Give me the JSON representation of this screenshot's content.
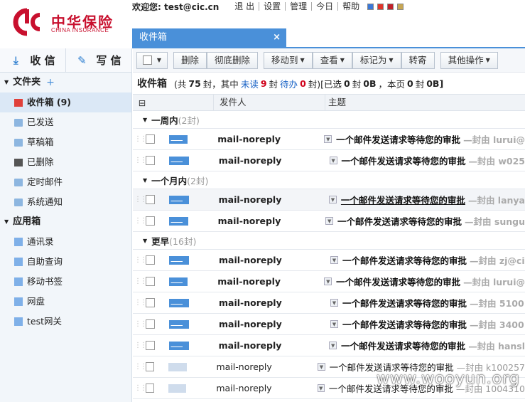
{
  "header": {
    "logo_cn": "中华保险",
    "logo_en": "CHINA INSURANCE",
    "welcome": "欢迎您: test@cic.cn",
    "links": [
      "退 出",
      "设置",
      "管理",
      "今日",
      "帮助"
    ],
    "skins": [
      "#3b78d8",
      "#e0352b",
      "#c0202a",
      "#c7a653"
    ]
  },
  "tab": {
    "label": "收件箱",
    "close": "×"
  },
  "sidebar": {
    "receive": "收 信",
    "compose": "写 信",
    "folders_title": "文件夹",
    "plus": "+",
    "folders": [
      {
        "label": "收件箱 (9)"
      },
      {
        "label": "已发送"
      },
      {
        "label": "草稿箱"
      },
      {
        "label": "已删除"
      },
      {
        "label": "定时邮件"
      },
      {
        "label": "系统通知"
      }
    ],
    "apps_title": "应用箱",
    "apps": [
      {
        "label": "通讯录"
      },
      {
        "label": "自助查询"
      },
      {
        "label": "移动书签"
      },
      {
        "label": "网盘"
      },
      {
        "label": "test网关"
      }
    ]
  },
  "toolbar": {
    "delete": "删除",
    "perm_delete": "彻底删除",
    "move": "移动到",
    "view": "查看",
    "mark": "标记为",
    "forward": "转寄",
    "more": "其他操作"
  },
  "summary": {
    "title": "收件箱",
    "t1": "(共",
    "total": "75",
    "t2": "封，其中",
    "unread_label": "未读",
    "unread": "9",
    "t3": "封",
    "todo_label": "待办",
    "todo": "0",
    "t4": "封)",
    "sel_pre": "[已选",
    "sel_count": "0",
    "sel_mid": "封",
    "sel_size": "0B",
    "sel_sep": "，本页",
    "page_count": "0",
    "page_mid": "封",
    "page_size": "0B]"
  },
  "columns": {
    "sender": "发件人",
    "subject": "主题"
  },
  "groups": [
    {
      "label": "一周内",
      "count": "(2封)",
      "rows": [
        {
          "sender": "mail-noreply",
          "subject": "一个邮件发送请求等待您的审批",
          "from": "—封由 lurui@",
          "unread": true
        },
        {
          "sender": "mail-noreply",
          "subject": "一个邮件发送请求等待您的审批",
          "from": "—封由 w025",
          "unread": true
        }
      ]
    },
    {
      "label": "一个月内",
      "count": "(2封)",
      "rows": [
        {
          "sender": "mail-noreply",
          "subject": "一个邮件发送请求等待您的审批",
          "from": "—封由 lanya",
          "unread": true,
          "hover": true
        },
        {
          "sender": "mail-noreply",
          "subject": "一个邮件发送请求等待您的审批",
          "from": "—封由 sungu",
          "unread": true
        }
      ]
    },
    {
      "label": "更早",
      "count": "(16封)",
      "rows": [
        {
          "sender": "mail-noreply",
          "subject": "一个邮件发送请求等待您的审批",
          "from": "—封由 zj@ci",
          "unread": true
        },
        {
          "sender": "mail-noreply",
          "subject": "一个邮件发送请求等待您的审批",
          "from": "—封由 lurui@",
          "unread": true
        },
        {
          "sender": "mail-noreply",
          "subject": "一个邮件发送请求等待您的审批",
          "from": "—封由 5100",
          "unread": true
        },
        {
          "sender": "mail-noreply",
          "subject": "一个邮件发送请求等待您的审批",
          "from": "—封由 3400",
          "unread": true
        },
        {
          "sender": "mail-noreply",
          "subject": "一个邮件发送请求等待您的审批",
          "from": "—封由 hansl",
          "unread": true
        },
        {
          "sender": "mail-noreply",
          "subject": "一个邮件发送请求等待您的审批",
          "from": "—封由 k100257",
          "unread": false
        },
        {
          "sender": "mail-noreply",
          "subject": "一个邮件发送请求等待您的审批",
          "from": "—封由 1004310",
          "unread": false
        }
      ]
    }
  ],
  "watermark": "www.wooyun.org"
}
